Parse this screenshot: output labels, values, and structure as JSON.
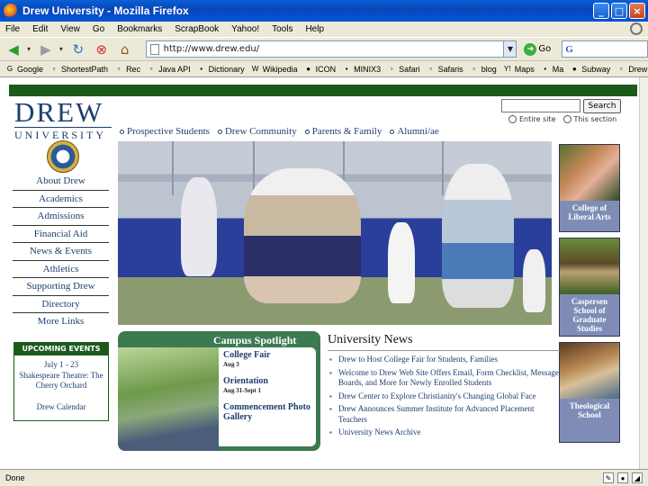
{
  "window": {
    "title": "Drew University - Mozilla Firefox",
    "buttons": [
      "_",
      "□",
      "×"
    ]
  },
  "menu": [
    "File",
    "Edit",
    "View",
    "Go",
    "Bookmarks",
    "ScrapBook",
    "Yahoo!",
    "Tools",
    "Help"
  ],
  "toolbar": {
    "url": "http://www.drew.edu/",
    "go_label": "Go",
    "search_engine": "G"
  },
  "bookmarks": [
    "Google",
    "ShortestPath",
    "Rec",
    "Java API",
    "Dictionary",
    "Wikipedia",
    "ICON",
    "MINIX3",
    "Safari",
    "Safaris",
    "blog",
    "Maps",
    "Ma",
    "Subway",
    "Drew"
  ],
  "site": {
    "logo": {
      "name": "DREW",
      "sub": "UNIVERSITY"
    },
    "search": {
      "button": "Search",
      "options": [
        "Entire site",
        "This section"
      ]
    },
    "audience": [
      "Prospective Students",
      "Drew Community",
      "Parents & Family",
      "Alumni/ae"
    ],
    "nav": [
      "About Drew",
      "Academics",
      "Admissions",
      "Financial Aid",
      "News & Events",
      "Athletics",
      "Supporting Drew",
      "Directory",
      "More Links"
    ],
    "schools": [
      {
        "label": "College of Liberal Arts"
      },
      {
        "label": "Caspersen School of Graduate Studies"
      },
      {
        "label": "Theological School"
      }
    ],
    "events": {
      "header": "UPCOMING EVENTS",
      "date": "July 1 - 23",
      "desc": "Shakespeare Theatre: The Cherry Orchard",
      "calendar": "Drew Calendar"
    },
    "spotlight": {
      "title": "Campus Spotlight",
      "items": [
        {
          "title": "College Fair",
          "date": "Aug 3"
        },
        {
          "title": "Orientation",
          "date": "Aug 31-Sept 1"
        },
        {
          "title": "Commencement Photo Gallery",
          "date": ""
        }
      ]
    },
    "news": {
      "title": "University News",
      "items": [
        "Drew to Host College Fair for Students, Families",
        "Welcome to Drew Web Site Offers Email, Form Checklist, Message Boards, and More for Newly Enrolled Students",
        "Drew Center to Explore Christianity's Changing Global Face",
        "Drew Announces Summer Institute for Advanced Placement Teachers",
        "University News Archive"
      ]
    }
  },
  "status": {
    "text": "Done"
  }
}
